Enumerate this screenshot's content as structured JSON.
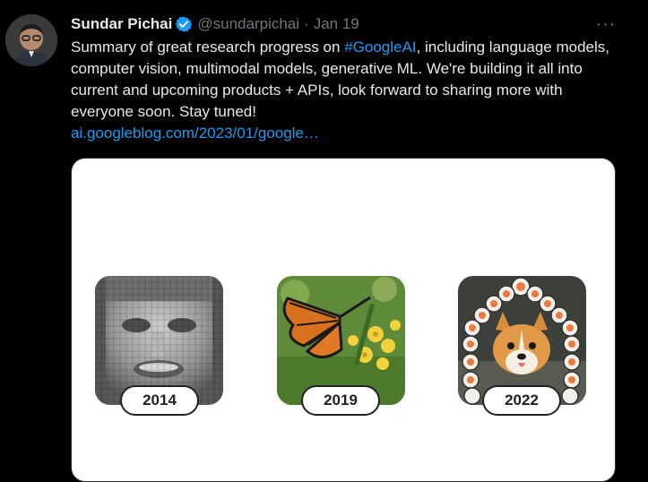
{
  "tweet": {
    "author_name": "Sundar Pichai",
    "handle": "@sundarpichai",
    "separator": "·",
    "date": "Jan 19",
    "more_label": "···",
    "text_before": "Summary of great research progress on ",
    "hashtag": "#GoogleAI",
    "text_after": ", including language models, computer vision, multimodal models, generative ML. We're building it all into current and upcoming products + APIs, look forward to sharing more with everyone soon. Stay tuned!",
    "link": "ai.googleblog.com/2023/01/google…"
  },
  "media": {
    "items": [
      {
        "year": "2014"
      },
      {
        "year": "2019"
      },
      {
        "year": "2022"
      }
    ]
  },
  "colors": {
    "background": "#000000",
    "text": "#e7e9ea",
    "secondary": "#71767b",
    "accent": "#1d9bf0"
  },
  "icons": {
    "verified": "verified-badge-icon",
    "more": "more-options-icon"
  }
}
